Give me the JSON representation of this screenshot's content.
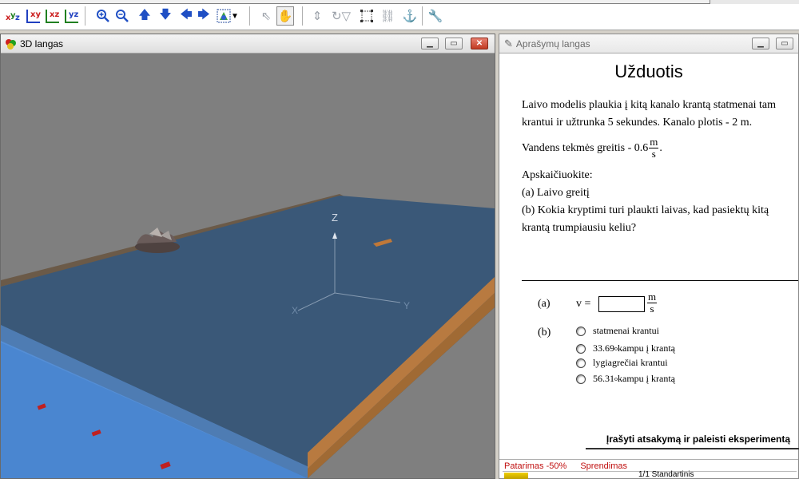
{
  "toolbar": {
    "view_buttons": [
      "xyz",
      "xy",
      "xz",
      "yz"
    ],
    "nav_icons": [
      "zoom-in-icon",
      "zoom-out-icon",
      "arrow-up-icon",
      "arrow-down-icon",
      "arrow-left-icon",
      "arrow-right-icon",
      "color-picker-icon"
    ],
    "tool_icons": [
      "pointer-icon",
      "hand-icon",
      "resize-icon",
      "rotate-icon",
      "select-box-icon",
      "link-icon",
      "anchor-icon",
      "wrench-icon"
    ]
  },
  "window3d": {
    "title": "3D langas",
    "axis_labels": {
      "z": "Z",
      "x": "X",
      "y": "Y"
    }
  },
  "desc_window": {
    "title": "Aprašymų langas",
    "heading": "Užduotis",
    "paragraph1": "Laivo modelis plaukia į kitą kanalo krantą statmenai tam krantui ir užtrunka  5 sekundes. Kanalo plotis -  2 m.",
    "current_prefix": "Vandens tekmės greitis -  0.6",
    "unit_num": "m",
    "unit_den": "s",
    "current_suffix": ".",
    "task_intro": "Apskaičiuokite:",
    "task_a": "(a) Laivo greitį",
    "task_b": "(b) Kokia kryptimi turi  plaukti laivas, kad pasiektų kitą krantą trumpiausiu keliu?",
    "answer_a_label": "(a)",
    "answer_v_label": "v =",
    "answer_v_value": "",
    "answer_b_label": "(b)",
    "options": [
      {
        "text": "statmenai krantui",
        "deg": "",
        "rest": ""
      },
      {
        "text": "33.69",
        "deg": "o",
        "rest": " kampu į krantą"
      },
      {
        "text": "lygiagrečiai krantui",
        "deg": "",
        "rest": ""
      },
      {
        "text": "56.31",
        "deg": "o",
        "rest": " kampu į krantą"
      }
    ],
    "submit_label": "Įrašyti atsakymą ir paleisti eksperimentą",
    "hint_label": "Patarimas -50%",
    "solution_label": "Sprendimas",
    "page_label": "1/1 Standartinis"
  },
  "colors": {
    "water_deep": "#3a5878",
    "water_near": "#4a86d0",
    "bank": "#b87a40",
    "ground": "#7f7f7f"
  }
}
